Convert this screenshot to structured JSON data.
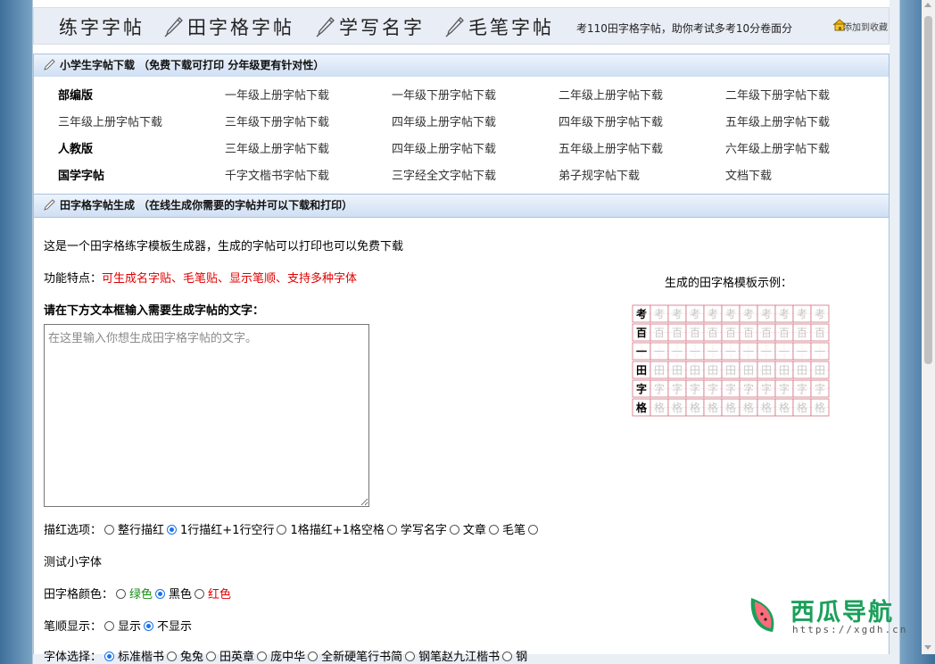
{
  "nav": {
    "items": [
      "练字字帖",
      "田字格字帖",
      "学写名字",
      "毛笔字帖"
    ],
    "slogan": "考110田字格字帖，助你考试多考10分卷面分",
    "favorite": "添加到收藏"
  },
  "panel1": {
    "title": "小学生字帖下载 （免费下载可打印 分年级更有针对性）",
    "rows": [
      [
        {
          "text": "部编版",
          "bold": true
        },
        {
          "text": "一年级上册字帖下载"
        },
        {
          "text": "一年级下册字帖下载"
        },
        {
          "text": "二年级上册字帖下载"
        },
        {
          "text": "二年级下册字帖下载"
        }
      ],
      [
        {
          "text": "三年级上册字帖下载"
        },
        {
          "text": "三年级下册字帖下载"
        },
        {
          "text": "四年级上册字帖下载"
        },
        {
          "text": "四年级下册字帖下载"
        },
        {
          "text": "五年级上册字帖下载"
        }
      ],
      [
        {
          "text": "人教版",
          "bold": true
        },
        {
          "text": "三年级上册字帖下载"
        },
        {
          "text": "四年级上册字帖下载"
        },
        {
          "text": "五年级上册字帖下载"
        },
        {
          "text": "六年级上册字帖下载"
        }
      ],
      [
        {
          "text": "国学字帖",
          "bold": true
        },
        {
          "text": "千字文楷书字帖下载"
        },
        {
          "text": "三字经全文字帖下载"
        },
        {
          "text": "弟子规字帖下载"
        },
        {
          "text": "文档下载"
        }
      ]
    ]
  },
  "panel2": {
    "title": "田字格字帖生成 （在线生成你需要的字帖并可以下载和打印）",
    "intro": "这是一个田字格练字模板生成器，生成的字帖可以打印也可以免费下载",
    "features_label": "功能特点：",
    "features_value": "可生成名字贴、毛笔贴、显示笔顺、支持多种字体",
    "input_label": "请在下方文本框输入需要生成字帖的文字：",
    "textarea_placeholder": "在这里输入你想生成田字格字帖的文字。",
    "sample_caption": "生成的田字格模板示例：",
    "sample_chars": [
      "考",
      "百",
      "一",
      "田",
      "字",
      "格"
    ],
    "trace": {
      "label": "描红选项：",
      "options": [
        {
          "text": "整行描红",
          "checked": false
        },
        {
          "text": "1行描红+1行空行",
          "checked": true
        },
        {
          "text": "1格描红+1格空格",
          "checked": false
        },
        {
          "text": "学写名字",
          "checked": false
        },
        {
          "text": "文章",
          "checked": false
        },
        {
          "text": "毛笔",
          "checked": false
        },
        {
          "text": "",
          "checked": false
        }
      ]
    },
    "small_font_test": "测试小字体",
    "grid_color": {
      "label": "田字格颜色：",
      "options": [
        {
          "text": "绿色",
          "checked": false,
          "color": "#1a8a1a"
        },
        {
          "text": "黑色",
          "checked": true,
          "color": "#000000"
        },
        {
          "text": "红色",
          "checked": false,
          "color": "#e00000"
        }
      ]
    },
    "stroke_order": {
      "label": "笔顺显示：",
      "options": [
        {
          "text": "显示",
          "checked": false
        },
        {
          "text": "不显示",
          "checked": true
        }
      ]
    },
    "font_select": {
      "label": "字体选择：",
      "options": [
        {
          "text": "标准楷书",
          "checked": true
        },
        {
          "text": "兔兔",
          "checked": false
        },
        {
          "text": "田英章",
          "checked": false
        },
        {
          "text": "庞中华",
          "checked": false
        },
        {
          "text": "全新硬笔行书简",
          "checked": false
        },
        {
          "text": "钢笔赵九江楷书",
          "checked": false
        },
        {
          "text": "钢",
          "checked": false
        }
      ]
    }
  },
  "watermark": {
    "title": "西瓜导航",
    "url": "https://xgdh.cn"
  },
  "colors": {
    "accent": "#1a73e8",
    "red": "#e00000",
    "green": "#1a8a1a",
    "grid_border": "#d07080",
    "panel_border": "#a9c2e0"
  }
}
